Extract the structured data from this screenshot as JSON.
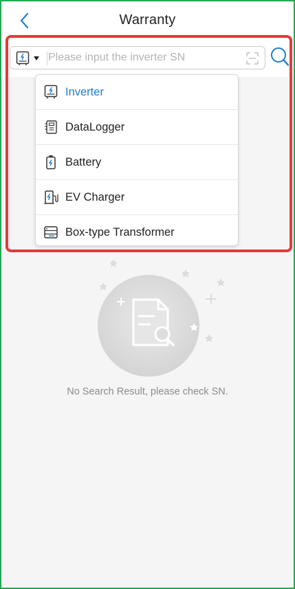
{
  "header": {
    "title": "Warranty"
  },
  "search": {
    "placeholder": "Please input the inverter SN",
    "value": "",
    "selected_type": "Inverter"
  },
  "dropdown": {
    "items": [
      {
        "label": "Inverter",
        "icon": "inverter-icon",
        "selected": true
      },
      {
        "label": "DataLogger",
        "icon": "datalogger-icon",
        "selected": false
      },
      {
        "label": "Battery",
        "icon": "battery-icon",
        "selected": false
      },
      {
        "label": "EV Charger",
        "icon": "ev-charger-icon",
        "selected": false
      },
      {
        "label": "Box-type Transformer",
        "icon": "transformer-icon",
        "selected": false
      }
    ]
  },
  "empty_state": {
    "message": "No Search Result, please check SN."
  },
  "colors": {
    "accent": "#1e7fd0",
    "highlight": "#e23b3b",
    "frame": "#1faa4f",
    "background": "#f5f5f5"
  }
}
